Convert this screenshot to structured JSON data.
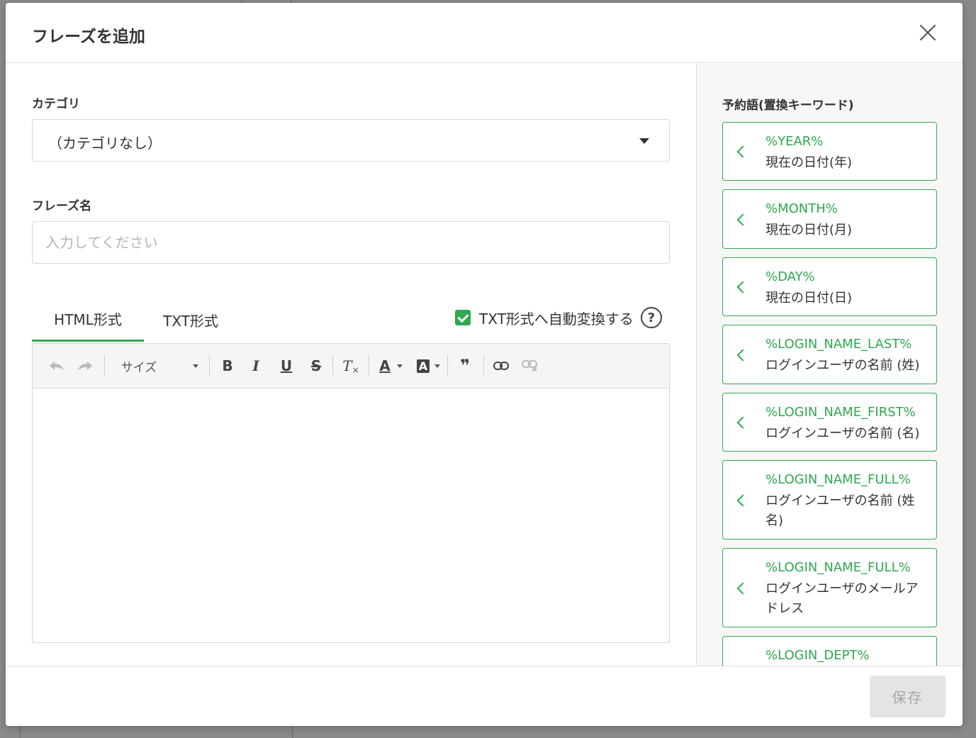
{
  "modal": {
    "title": "フレーズを追加"
  },
  "form": {
    "category_label": "カテゴリ",
    "category_value": "（カテゴリなし）",
    "phrase_name_label": "フレーズ名",
    "phrase_name_placeholder": "入力してください",
    "phrase_name_value": ""
  },
  "tabs": [
    {
      "label": "HTML形式",
      "active": true
    },
    {
      "label": "TXT形式",
      "active": false
    }
  ],
  "auto_convert": {
    "label": "TXT形式へ自動変換する",
    "checked": true,
    "help": "?"
  },
  "toolbar": {
    "size_label": "サイズ",
    "bold": "B",
    "italic": "I",
    "underline": "U",
    "strike": "S",
    "clear_format": "T",
    "font_color": "A",
    "bg_color": "A",
    "quote": "❞"
  },
  "keywords": {
    "title": "予約語(置換キーワード)",
    "items": [
      {
        "code": "%YEAR%",
        "desc": "現在の日付(年)"
      },
      {
        "code": "%MONTH%",
        "desc": "現在の日付(月)"
      },
      {
        "code": "%DAY%",
        "desc": "現在の日付(日)"
      },
      {
        "code": "%LOGIN_NAME_LAST%",
        "desc": "ログインユーザの名前 (姓)"
      },
      {
        "code": "%LOGIN_NAME_FIRST%",
        "desc": "ログインユーザの名前 (名)"
      },
      {
        "code": "%LOGIN_NAME_FULL%",
        "desc": "ログインユーザの名前 (姓名)"
      },
      {
        "code": "%LOGIN_NAME_FULL%",
        "desc": "ログインユーザのメールアドレス"
      },
      {
        "code": "%LOGIN_DEPT%",
        "desc": ""
      }
    ]
  },
  "footer": {
    "save_label": "保存"
  },
  "colors": {
    "accent": "#2fa84f",
    "disabled_button": "#e4e4e4"
  }
}
